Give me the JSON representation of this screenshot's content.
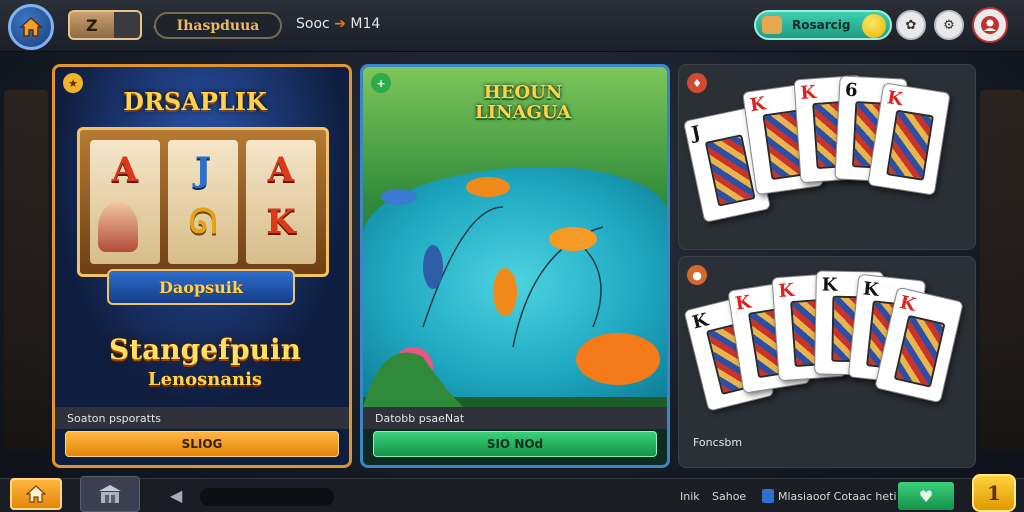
{
  "topbar": {
    "pill_letter": "Z",
    "title": "Ihaspduua",
    "score_label": "Sooc",
    "score_value": "M14",
    "right_pill_label": "Rosarcig"
  },
  "slots": {
    "title": "DRSAPLIK",
    "reels": [
      "A",
      "J",
      "A",
      "K"
    ],
    "banner": "Daopsuik",
    "logo_line1": "Stangefpuin",
    "logo_line2": "Lenosnanis",
    "caption": "Soaton psporatts",
    "play_label": "SLIOG"
  },
  "fishing": {
    "title_line1": "HEOUN",
    "title_line2": "LINAGUA",
    "caption": "Datobb psaeNat",
    "play_label": "SIO NOd"
  },
  "cards": {
    "top_ranks": [
      "J",
      "K",
      "K",
      "6",
      "K"
    ],
    "bottom_ranks": [
      "K",
      "K",
      "K",
      "K",
      "K",
      "K"
    ],
    "caption": "Foncsbm"
  },
  "bottombar": {
    "label_a": "Inik",
    "label_b": "Sahoe",
    "label_c": "Mlasiaoof Cotaac heti"
  },
  "colors": {
    "accent_orange": "#e2860a",
    "accent_green": "#14934a",
    "accent_teal": "#1f9b85",
    "panel_orange_border": "#e0952f",
    "panel_blue_border": "#3b86c7"
  },
  "icons": {
    "home": "home-icon",
    "gear": "gear-icon",
    "settings": "settings-icon",
    "profile": "profile-icon",
    "shop": "shop-icon",
    "back": "back-arrow-icon",
    "heart": "heart-icon",
    "coin": "coin-icon"
  }
}
